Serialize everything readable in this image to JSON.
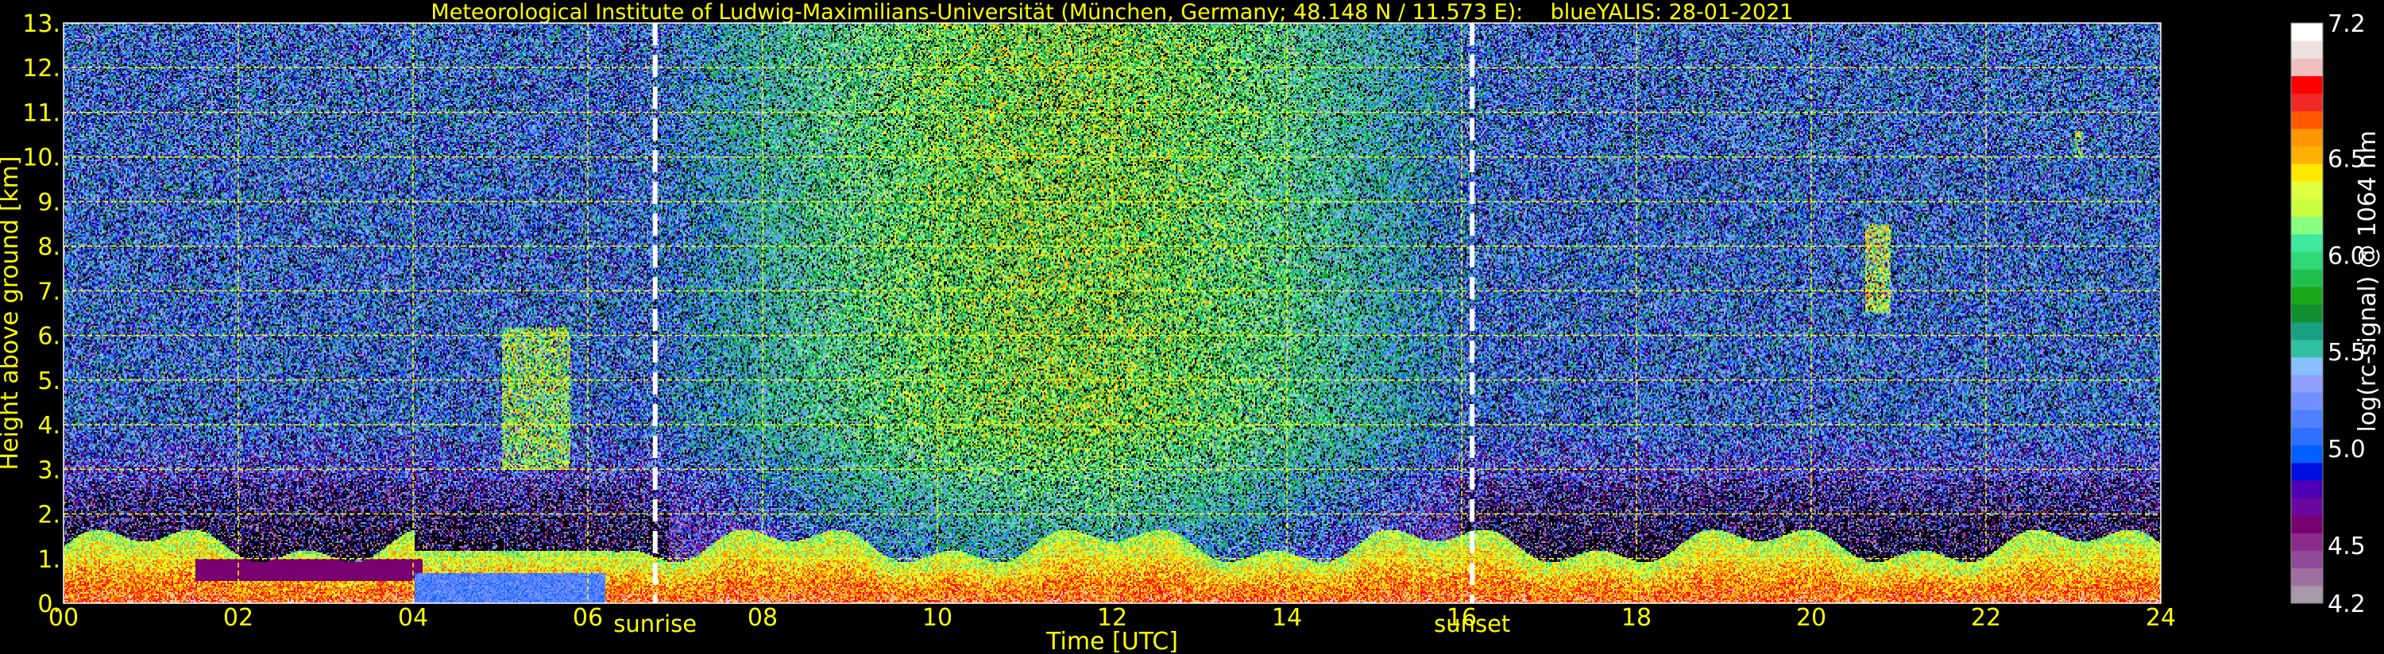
{
  "title": "Meteorological Institute of Ludwig-Maximilians-Universität (München, Germany; 48.148 N / 11.573 E):    blueYALIS: 28-01-2021",
  "colors": {
    "axis_text": "#ffff00",
    "grid": "#ffff00",
    "colorbar_text": "#ffffff",
    "background": "#000000"
  },
  "chart_data": {
    "type": "heatmap",
    "title": "Meteorological Institute of Ludwig-Maximilians-Universität (München, Germany; 48.148 N / 11.573 E):    blueYALIS: 28-01-2021",
    "xlabel": "Time [UTC]",
    "ylabel": "Height above ground [km]",
    "xlim": [
      0,
      24
    ],
    "ylim": [
      0,
      13
    ],
    "xticks": [
      "00",
      "02",
      "04",
      "06",
      "08",
      "10",
      "12",
      "14",
      "16",
      "18",
      "20",
      "22",
      "24"
    ],
    "yticks": [
      "0.",
      "1.",
      "2.",
      "3.",
      "4.",
      "5.",
      "6.",
      "7.",
      "8.",
      "9.",
      "10.",
      "11.",
      "12.",
      "13."
    ],
    "grid": true,
    "annotations": [
      {
        "label": "sunrise",
        "time": 6.77
      },
      {
        "label": "sunset",
        "time": 16.12
      }
    ],
    "colorbar": {
      "label": "log(rc-signal) @ 1064 nm",
      "range": [
        4.2,
        7.2
      ],
      "ticks": [
        "7.2",
        "6.5",
        "6.0",
        "5.5",
        "5.0",
        "4.5",
        "4.2"
      ],
      "tick_values": [
        7.2,
        6.5,
        6.0,
        5.5,
        5.0,
        4.5,
        4.2
      ],
      "colors": [
        "#a898a8",
        "#a070a0",
        "#904c98",
        "#8a2a8a",
        "#780070",
        "#6a08a0",
        "#5000b4",
        "#0010e0",
        "#0060ff",
        "#3070ff",
        "#5080ff",
        "#7090ff",
        "#90a0ff",
        "#88c0ff",
        "#30c0a0",
        "#18a080",
        "#109030",
        "#18a818",
        "#20c050",
        "#30d878",
        "#40e8a0",
        "#88ff80",
        "#c8ff40",
        "#e0ff40",
        "#ffe800",
        "#ffb000",
        "#ff9800",
        "#ff5800",
        "#f02828",
        "#ff0000",
        "#f0c0c0",
        "#ece0e0",
        "#ffffff"
      ]
    },
    "features": [
      {
        "name": "boundary layer aerosol",
        "time": [
          0,
          24
        ],
        "height_km": [
          0,
          1.8
        ],
        "log_signal": 6.6
      },
      {
        "name": "cloud",
        "time": [
          5.0,
          5.8
        ],
        "height_km": [
          3.0,
          6.2
        ],
        "log_signal": 6.2
      },
      {
        "name": "cloud",
        "time": [
          20.6,
          20.9
        ],
        "height_km": [
          6.5,
          8.5
        ],
        "log_signal": 6.3
      },
      {
        "name": "cloud",
        "time": [
          23.0,
          23.1
        ],
        "height_km": [
          10.0,
          10.6
        ],
        "log_signal": 6.3
      }
    ]
  }
}
